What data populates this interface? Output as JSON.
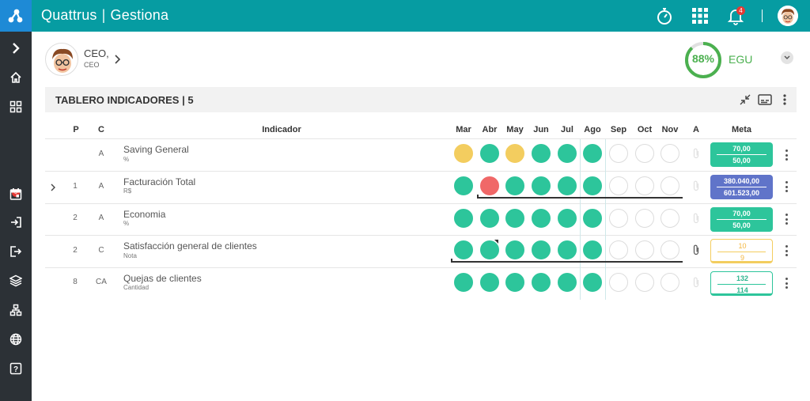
{
  "app": {
    "brand": "Quattrus",
    "module": "Gestiona",
    "notification_count": "4"
  },
  "sidebar": {
    "badge": "5"
  },
  "user": {
    "name": "CEO,",
    "role": "CEO"
  },
  "score": {
    "value": "88%",
    "label": "EGU",
    "fraction": 0.88
  },
  "panel": {
    "title": "TABLERO INDICADORES | 5"
  },
  "table": {
    "headers": {
      "p": "P",
      "c": "C",
      "indicator": "Indicador",
      "a": "A",
      "meta": "Meta"
    },
    "months": [
      "Mar",
      "Abr",
      "May",
      "Jun",
      "Jul",
      "Ago",
      "Sep",
      "Oct",
      "Nov"
    ],
    "rows": [
      {
        "p": "",
        "c": "A",
        "name": "Saving General",
        "unit": "%",
        "status": [
          "yellow",
          "green",
          "yellow",
          "green",
          "green",
          "green",
          "empty",
          "empty",
          "empty"
        ],
        "meta": {
          "v1": "70,00",
          "v2": "50,00",
          "style": "green"
        }
      },
      {
        "p": "1",
        "c": "A",
        "name": "Facturación Total",
        "unit": "R$",
        "status": [
          "green",
          "red",
          "green",
          "green",
          "green",
          "green",
          "empty",
          "empty",
          "empty"
        ],
        "meta": {
          "v1": "380.040,00",
          "v2": "601.523,00",
          "style": "blue"
        }
      },
      {
        "p": "2",
        "c": "A",
        "name": "Economia",
        "unit": "%",
        "status": [
          "green",
          "green",
          "green",
          "green",
          "green",
          "green",
          "empty",
          "empty",
          "empty"
        ],
        "meta": {
          "v1": "70,00",
          "v2": "50,00",
          "style": "green"
        }
      },
      {
        "p": "2",
        "c": "C",
        "name": "Satisfacción general de clientes",
        "unit": "Nota",
        "status": [
          "green",
          "green",
          "green",
          "green",
          "green",
          "green",
          "empty",
          "empty",
          "empty"
        ],
        "meta": {
          "v1": "10",
          "v2": "9",
          "style": "outline-yellow"
        }
      },
      {
        "p": "8",
        "c": "CA",
        "name": "Quejas de clientes",
        "unit": "Cantidad",
        "status": [
          "green",
          "green",
          "green",
          "green",
          "green",
          "green",
          "empty",
          "empty",
          "empty"
        ],
        "meta": {
          "v1": "132",
          "v2": "114",
          "style": "outline-green"
        }
      }
    ]
  },
  "colors": {
    "teal": "#069ca2",
    "green": "#2dc59b",
    "yellow": "#f3cd5f",
    "red": "#f06868",
    "blue": "#6074c9"
  }
}
